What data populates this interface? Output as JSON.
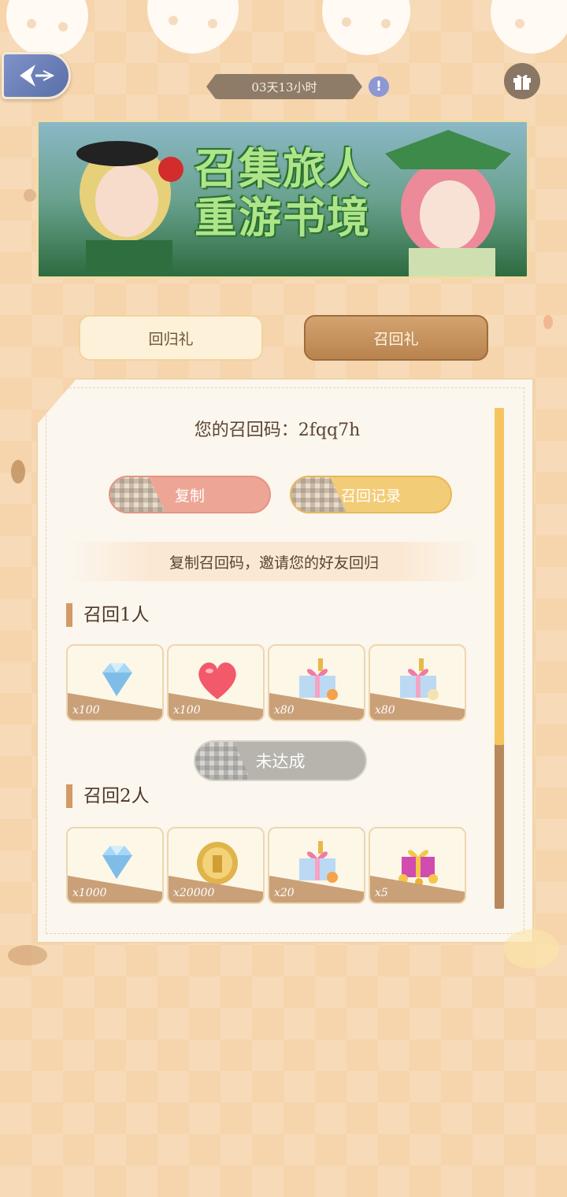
{
  "header": {
    "timer_text": "03天13小时"
  },
  "banner": {
    "title_line1": "召集旅人",
    "title_line2": "重游书境"
  },
  "tabs": [
    {
      "label": "回归礼",
      "active": false
    },
    {
      "label": "召回礼",
      "active": true
    }
  ],
  "panel": {
    "code_label": "您的召回码：",
    "code_value": "2fqq7h",
    "copy_button": "复制",
    "record_button": "召回记录",
    "hint": "复制召回码，邀请您的好友回归",
    "tier1": {
      "title": "召回1人",
      "items": [
        {
          "icon": "diamond-icon",
          "qty": "x100"
        },
        {
          "icon": "heart-icon",
          "qty": "x100"
        },
        {
          "icon": "gift-box-icon",
          "qty": "x80"
        },
        {
          "icon": "gift-box-icon",
          "qty": "x80"
        }
      ],
      "status_button": "未达成"
    },
    "tier2": {
      "title": "召回2人",
      "items": [
        {
          "icon": "diamond-icon",
          "qty": "x1000"
        },
        {
          "icon": "gold-coin-icon",
          "qty": "x20000"
        },
        {
          "icon": "gift-box-icon",
          "qty": "x20"
        },
        {
          "icon": "treasure-gift-icon",
          "qty": "x5"
        }
      ]
    }
  },
  "colors": {
    "background": "#f6d4ac",
    "accent_brown": "#b9834e",
    "copy_button": "#eda696",
    "record_button": "#f3cc78",
    "scroll_thumb": "#f7c560"
  }
}
